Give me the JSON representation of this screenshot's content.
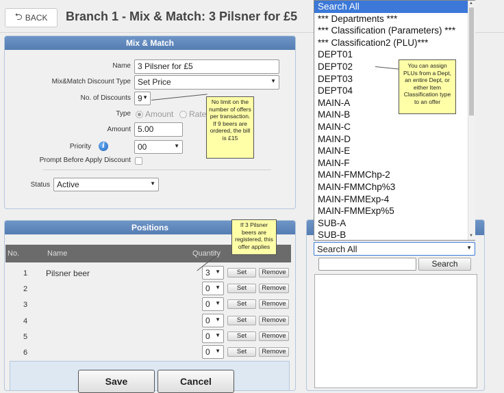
{
  "header": {
    "back_label": "BACK",
    "title": "Branch 1 - Mix & Match: 3 Pilsner for £5"
  },
  "mix_match": {
    "panel_title": "Mix & Match",
    "name_label": "Name",
    "name_value": "3 Pilsner for £5",
    "discount_type_label": "Mix&Match Discount Type",
    "discount_type_value": "Set Price",
    "num_discounts_label": "No. of Discounts",
    "num_discounts_value": "9",
    "type_label": "Type",
    "type_options": [
      "Amount",
      "Rate"
    ],
    "type_selected": "Amount",
    "amount_label": "Amount",
    "amount_value": "5.00",
    "priority_label": "Priority",
    "priority_value": "00",
    "prompt_label": "Prompt Before Apply Discount",
    "prompt_checked": false,
    "status_label": "Status",
    "status_value": "Active"
  },
  "callouts": {
    "discounts_note": "No limit on the number of offers per transaction. If 9 beers are ordered, the bill is £15",
    "quantity_note": "If 3 Pilsner beers are registered, this offer applies",
    "dept_note": "You can assign PLUs from a Dept, an entire Dept, or either Item Classification type to an offer"
  },
  "positions": {
    "panel_title": "Positions",
    "columns": [
      "No.",
      "Name",
      "Quantity"
    ],
    "set_label": "Set",
    "remove_label": "Remove",
    "rows": [
      {
        "no": "1",
        "name": "Pilsner beer",
        "qty": "3"
      },
      {
        "no": "2",
        "name": "",
        "qty": "0"
      },
      {
        "no": "3",
        "name": "",
        "qty": "0"
      },
      {
        "no": "4",
        "name": "",
        "qty": "0"
      },
      {
        "no": "5",
        "name": "",
        "qty": "0"
      },
      {
        "no": "6",
        "name": "",
        "qty": "0"
      }
    ]
  },
  "footer": {
    "save_label": "Save",
    "cancel_label": "Cancel"
  },
  "search_panel": {
    "dropdown_value": "Search All",
    "search_input_value": "",
    "search_button_label": "Search",
    "list_items": [
      "Search All",
      "*** Departments ***",
      "*** Classification (Parameters) ***",
      "*** Classification2 (PLU)***",
      "DEPT01",
      "DEPT02",
      "DEPT03",
      "DEPT04",
      "MAIN-A",
      "MAIN-B",
      "MAIN-C",
      "MAIN-D",
      "MAIN-E",
      "MAIN-F",
      "MAIN-FMMChp-2",
      "MAIN-FMMChp%3",
      "MAIN-FMMExp-4",
      "MAIN-FMMExp%5",
      "SUB-A",
      "SUB-B"
    ],
    "selected_index": 0
  }
}
